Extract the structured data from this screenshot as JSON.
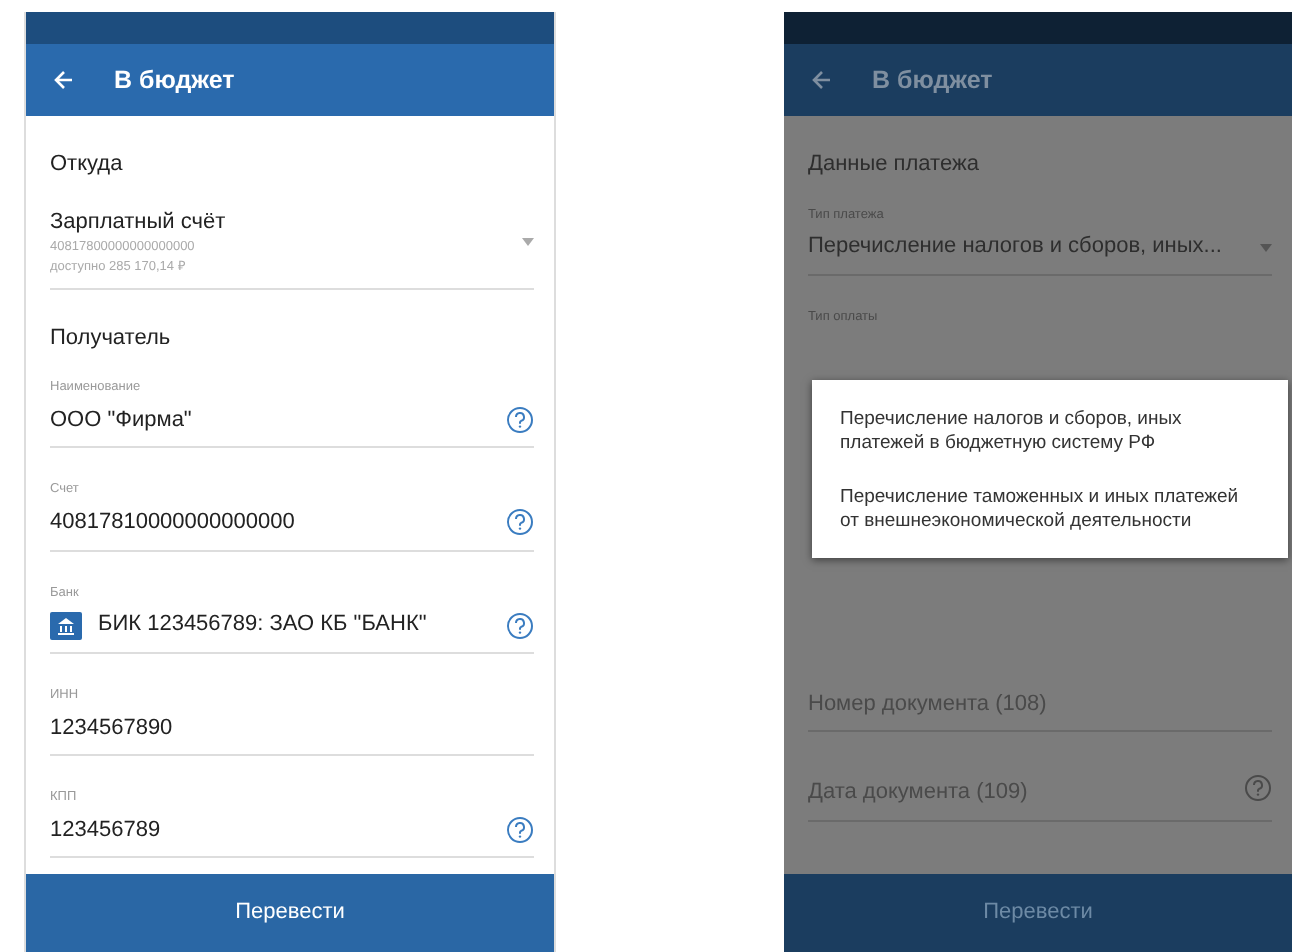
{
  "screens": [
    {
      "dimmed": false,
      "app_bar": {
        "title": "В бюджет"
      },
      "sections": [
        {
          "heading": "Откуда",
          "fields": [
            {
              "kind": "account",
              "value": "Зарплатный счёт",
              "lines": [
                "40817800000000000000",
                "доступно 285 170,14 ₽"
              ]
            }
          ]
        },
        {
          "heading": "Получатель",
          "fields": [
            {
              "kind": "text",
              "label": "Наименование",
              "value": "ООО \"Фирма\"",
              "help": true
            },
            {
              "kind": "text",
              "label": "Счет",
              "value": "40817810000000000000",
              "help": true
            },
            {
              "kind": "bank",
              "label": "Банк",
              "value": "БИК 123456789: ЗАО КБ \"БАНК\"",
              "help": true
            },
            {
              "kind": "text",
              "label": "ИНН",
              "value": "1234567890",
              "help": false
            },
            {
              "kind": "text",
              "label": "КПП",
              "value": "123456789",
              "help": true
            }
          ]
        }
      ],
      "button": "Перевести"
    },
    {
      "dimmed": true,
      "app_bar": {
        "title": "В бюджет"
      },
      "sections": [
        {
          "heading": "Данные платежа",
          "fields": [
            {
              "kind": "select",
              "label": "Тип платежа",
              "value": "Перечисление налогов и сборов, иных..."
            },
            {
              "kind": "hidden",
              "label": "Тип оплаты"
            },
            {
              "kind": "text",
              "placeholder": "Номер документа (108)",
              "help": false
            },
            {
              "kind": "text",
              "placeholder": "Дата документа (109)",
              "help": true
            }
          ]
        }
      ],
      "popup": {
        "options": [
          "Перечисление налогов и сборов, иных платежей в бюджетную систему РФ",
          "Перечисление таможенных и иных платежей от внешнеэкономической деятельности"
        ]
      },
      "button": "Перевести"
    }
  ]
}
